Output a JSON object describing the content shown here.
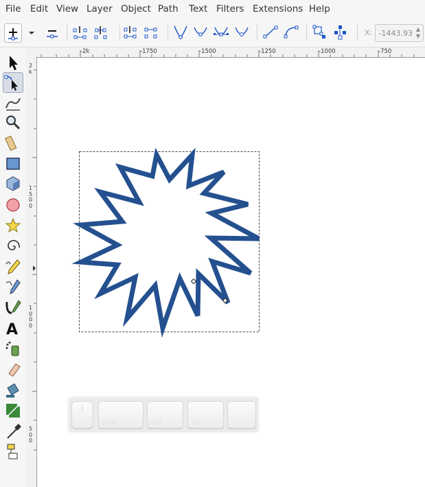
{
  "menubar": {
    "items": [
      "File",
      "Edit",
      "View",
      "Layer",
      "Object",
      "Path",
      "Text",
      "Filters",
      "Extensions",
      "Help"
    ]
  },
  "toolbar": {
    "buttons": [
      "insert-node-icon",
      "delete-node-icon",
      "join-nodes-icon",
      "break-path-icon",
      "join-segment-icon",
      "delete-segment-icon",
      "cusp-node-icon",
      "smooth-node-icon",
      "symmetric-node-icon",
      "auto-smooth-node-icon",
      "segment-line-icon",
      "segment-curve-icon",
      "object-to-path-icon",
      "stroke-to-path-icon"
    ],
    "x_label": "X:",
    "x_value": "-1443.93"
  },
  "toolbox": {
    "active_tool": "node-tool",
    "tools": [
      "selector-tool",
      "node-tool",
      "tweak-tool",
      "zoom-tool",
      "measure-tool",
      "rectangle-tool",
      "box-3d-tool",
      "ellipse-tool",
      "star-tool",
      "spiral-tool",
      "pencil-tool",
      "pen-tool",
      "calligraphy-tool",
      "text-tool",
      "spray-tool",
      "eraser-tool",
      "paint-bucket-tool",
      "gradient-tool",
      "dropper-tool",
      "connector-tool"
    ]
  },
  "rulers": {
    "horizontal_labels": [
      "-2k",
      "-1750",
      "-1500",
      "-1250",
      "-1000",
      "-750"
    ],
    "vertical_labels": [
      "2 k",
      "1 5 0 0",
      "1 0 0 0",
      "5 0 0"
    ]
  },
  "shape": {
    "stroke_color": "#24508f",
    "fill_color": "#ffffff"
  },
  "keys_overlay": {
    "keys": [
      "",
      "shift",
      "ctrl",
      "alt",
      ""
    ]
  },
  "colors": {
    "chrome_background": "#f6f6f6",
    "icon_accent": "#1f56c8"
  }
}
